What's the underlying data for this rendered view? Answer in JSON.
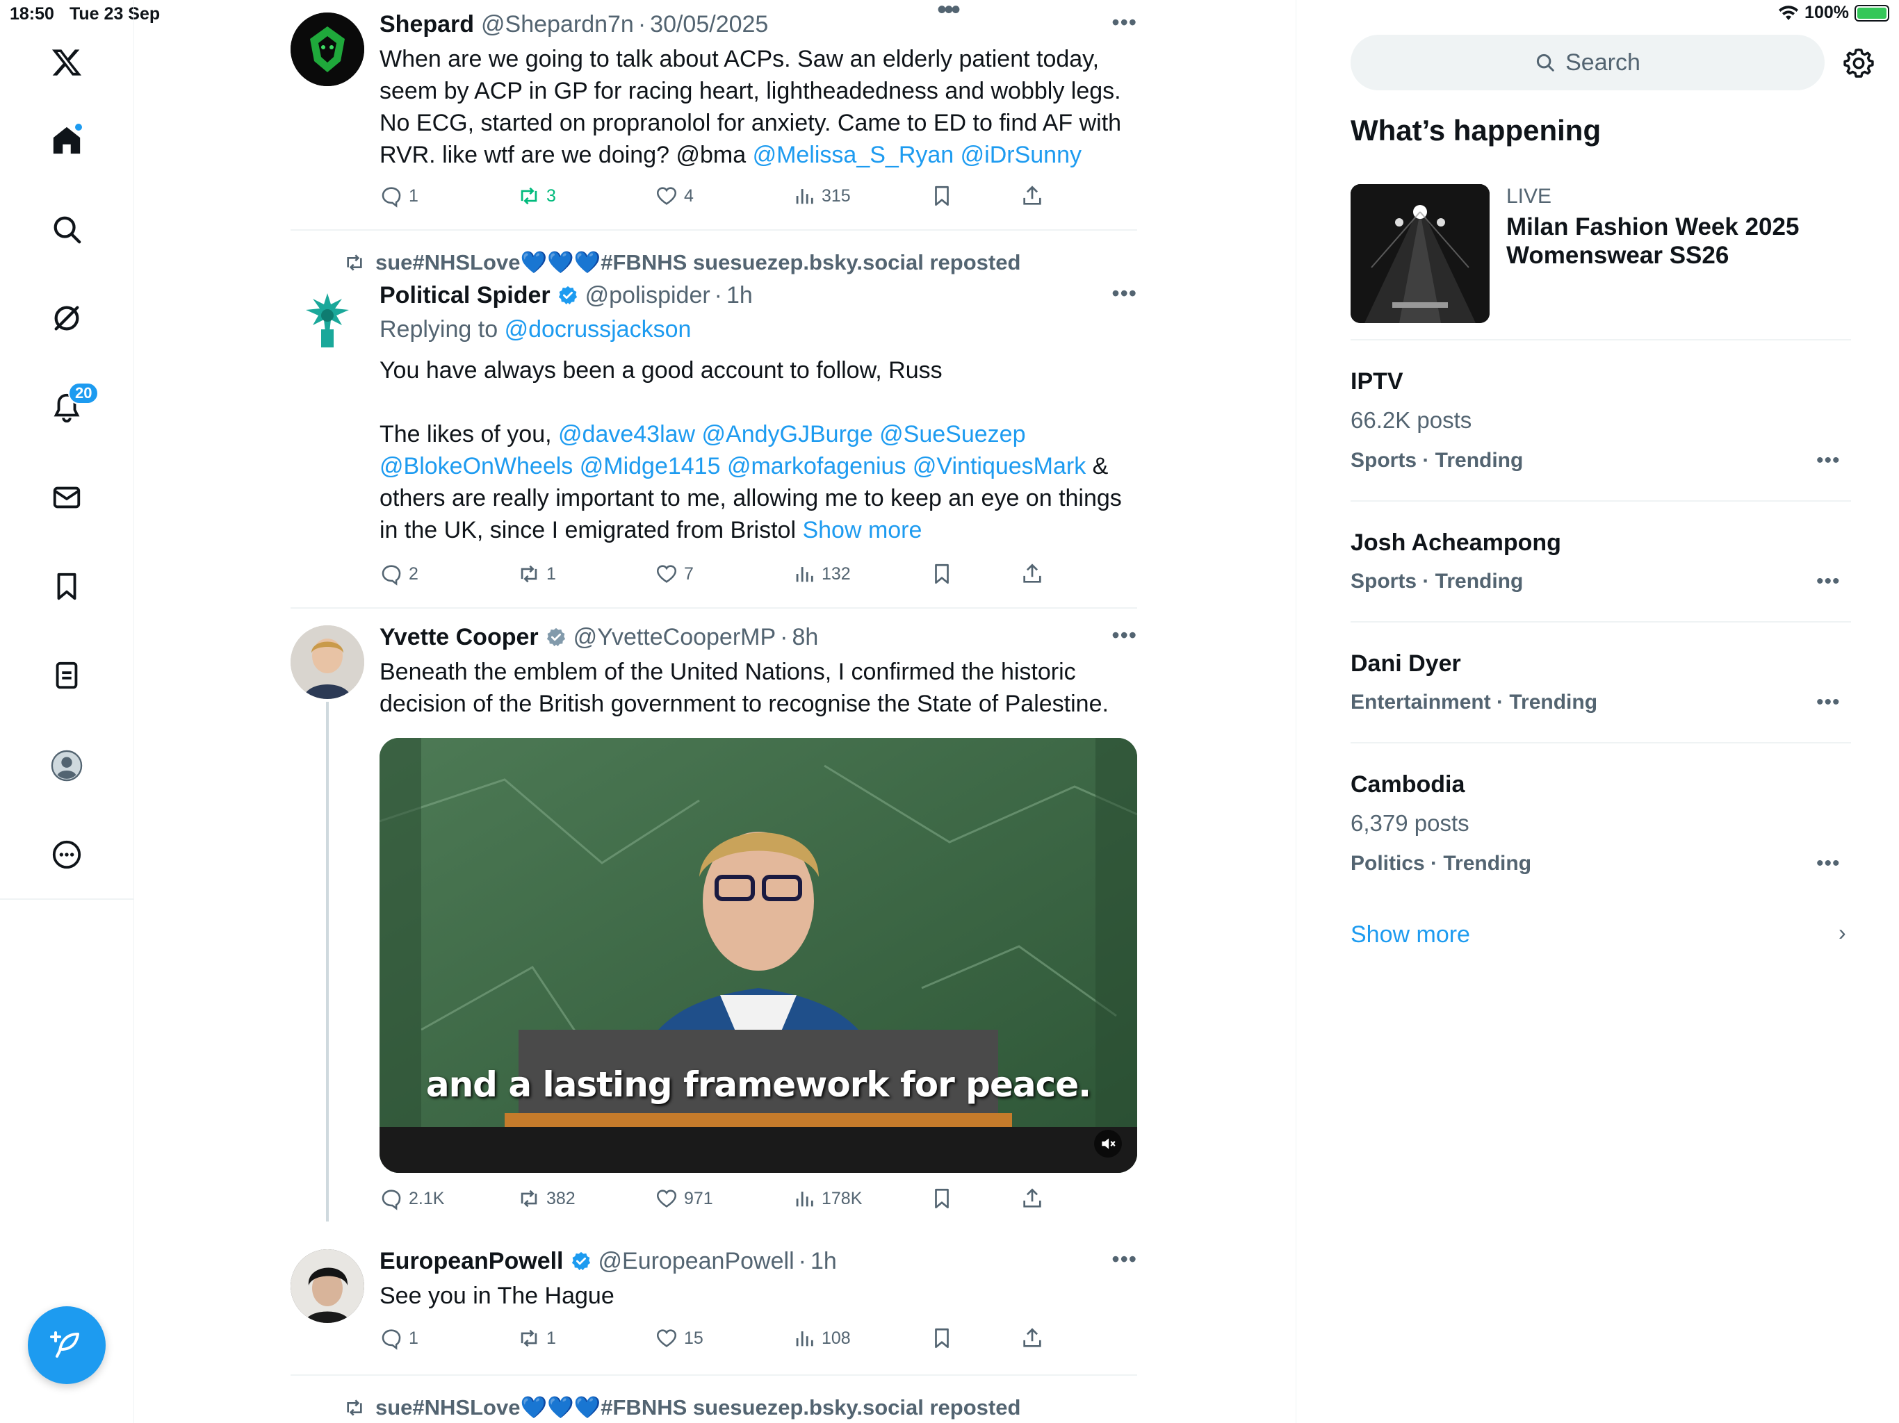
{
  "status_bar": {
    "time": "18:50",
    "date": "Tue 23 Sep",
    "battery": "100%"
  },
  "sidebar": {
    "logo": "x-logo-icon",
    "items": [
      {
        "name": "home",
        "icon": "home-icon"
      },
      {
        "name": "explore",
        "icon": "search-icon"
      },
      {
        "name": "grok",
        "icon": "grok-icon"
      },
      {
        "name": "notifications",
        "icon": "bell-icon",
        "badge": "20"
      },
      {
        "name": "messages",
        "icon": "mail-icon"
      },
      {
        "name": "bookmarks",
        "icon": "bookmark-icon"
      },
      {
        "name": "lists",
        "icon": "list-icon"
      },
      {
        "name": "profile",
        "icon": "profile-icon"
      },
      {
        "name": "more",
        "icon": "more-circle-icon"
      }
    ],
    "compose_icon": "compose-feather-icon"
  },
  "feed": {
    "tweets": [
      {
        "name": "Shepard",
        "handle": "@Shepardn7n",
        "sep": "·",
        "time": "30/05/2025",
        "text": "When are we going to talk about ACPs. Saw an elderly patient today, seem by ACP in GP for racing heart, lightheadedness and wobbly legs. No ECG, started on propranolol for anxiety. Came to ED to find AF with RVR. like wtf are we doing? @bma ",
        "mentions": "@Melissa_S_Ryan @iDrSunny",
        "replies": "1",
        "retweets": "3",
        "likes": "4",
        "views": "315"
      },
      {
        "repost_context": "sue#NHSLove💙💙💙#FBNHS suesuezep.bsky.social reposted",
        "name": "Political Spider",
        "handle": "@polispider",
        "sep": "·",
        "time": "1h",
        "replying_label": "Replying to",
        "replying_to": "@docrussjackson",
        "text_1": "You have always been a good account to follow, Russ",
        "text_2_start": "The likes of you, ",
        "mentions": "@dave43law @AndyGJBurge @SueSuezep @BlokeOnWheels @Midge1415 @markofagenius @VintiquesMark",
        "text_2_end": " & others are really important to me, allowing me to keep an eye on things in the UK, since I emigrated from Bristol ",
        "show_more": "Show more",
        "replies": "2",
        "retweets": "1",
        "likes": "7",
        "views": "132"
      },
      {
        "name": "Yvette Cooper",
        "handle": "@YvetteCooperMP",
        "sep": "·",
        "time": "8h",
        "text": "Beneath the emblem of the United Nations, I confirmed the historic decision of the British government to recognise the State of Palestine.",
        "video_caption": "and a lasting framework for peace.",
        "replies": "2.1K",
        "retweets": "382",
        "likes": "971",
        "views": "178K"
      },
      {
        "name": "EuropeanPowell",
        "handle": "@EuropeanPowell",
        "sep": "·",
        "time": "1h",
        "text": "See you in The Hague",
        "replies": "1",
        "retweets": "1",
        "likes": "15",
        "views": "108"
      }
    ],
    "bottom_repost_context": "sue#NHSLove💙💙💙#FBNHS suesuezep.bsky.social reposted"
  },
  "right": {
    "search_placeholder": "Search",
    "whats_happening": "What’s happening",
    "live": {
      "label": "LIVE",
      "title": "Milan Fashion Week 2025 Womenswear SS26"
    },
    "trends": [
      {
        "name": "IPTV",
        "posts": "66.2K posts",
        "category": "Sports · Trending"
      },
      {
        "name": "Josh Acheampong",
        "posts": "",
        "category": "Sports · Trending"
      },
      {
        "name": "Dani Dyer",
        "posts": "",
        "category": "Entertainment · Trending"
      },
      {
        "name": "Cambodia",
        "posts": "6,379 posts",
        "category": "Politics · Trending"
      }
    ],
    "show_more": "Show more"
  },
  "colors": {
    "accent": "#1d9bf0",
    "retweet_green": "#00ba7c",
    "secondary_text": "#536471"
  }
}
